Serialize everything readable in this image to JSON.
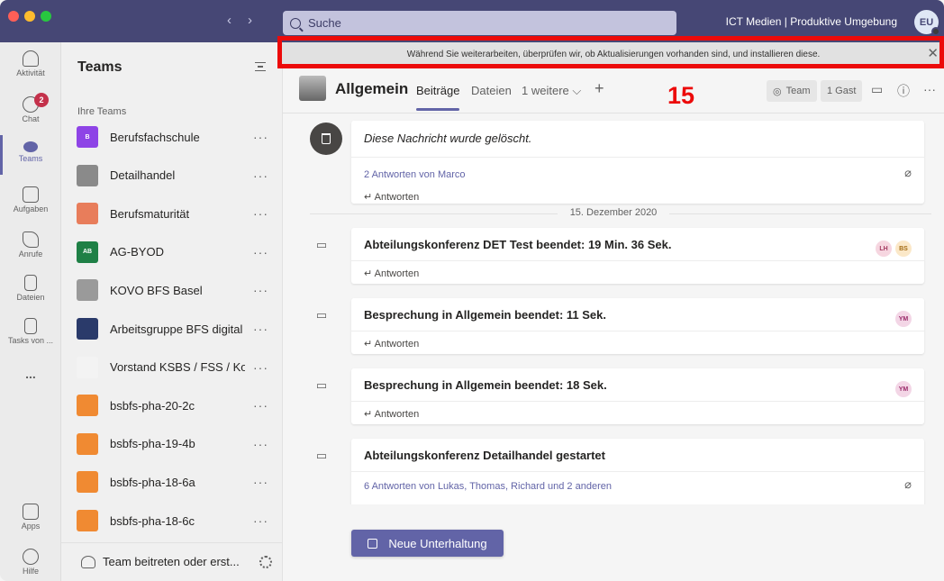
{
  "app": {
    "org_label": "ICT Medien | Produktive Umgebung",
    "avatar_initials": "EU",
    "search_placeholder": "Suche"
  },
  "rail": {
    "items": [
      {
        "label": "Aktivität"
      },
      {
        "label": "Chat",
        "badge": "2"
      },
      {
        "label": "Teams"
      },
      {
        "label": "Aufgaben"
      },
      {
        "label": "Anrufe"
      },
      {
        "label": "Dateien"
      },
      {
        "label": "Tasks von ..."
      },
      {
        "label": "..."
      },
      {
        "label": "Apps"
      },
      {
        "label": "Hilfe"
      }
    ]
  },
  "teams_panel": {
    "title": "Teams",
    "section": "Ihre Teams",
    "teams": [
      {
        "name": "Berufsfachschule",
        "tile": "B",
        "color": "#8e44e6"
      },
      {
        "name": "Detailhandel",
        "tile": "",
        "color": "#8a8a8a"
      },
      {
        "name": "Berufsmaturität",
        "tile": "",
        "color": "#e87d5b"
      },
      {
        "name": "AG-BYOD",
        "tile": "AB",
        "color": "#1f8046"
      },
      {
        "name": "KOVO BFS Basel",
        "tile": "",
        "color": "#9a9a9a"
      },
      {
        "name": "Arbeitsgruppe BFS digital",
        "tile": "",
        "color": "#2a3a6a"
      },
      {
        "name": "Vorstand KSBS / FSS / Ko...",
        "tile": "",
        "color": "#f3f3f3"
      },
      {
        "name": "bsbfs-pha-20-2c",
        "tile": "",
        "color": "#f08a32"
      },
      {
        "name": "bsbfs-pha-19-4b",
        "tile": "",
        "color": "#f08a32"
      },
      {
        "name": "bsbfs-pha-18-6a",
        "tile": "",
        "color": "#f08a32"
      },
      {
        "name": "bsbfs-pha-18-6c",
        "tile": "",
        "color": "#f08a32"
      }
    ],
    "more": "···",
    "join_label": "Team beitreten oder erst..."
  },
  "update_bar": {
    "text": "Während Sie weiterarbeiten, überprüfen wir, ob Aktualisierungen vorhanden sind, und installieren diese.",
    "close": "✕"
  },
  "annotation": {
    "number": "15"
  },
  "channel": {
    "name": "Allgemein",
    "tabs": [
      "Beiträge",
      "Dateien",
      "1 weitere ⌵"
    ],
    "add": "+",
    "team_pill": "Team",
    "guest_pill": "1 Gast"
  },
  "feed": {
    "deleted_message": "Diese Nachricht wurde gelöscht.",
    "deleted_replies": "2 Antworten von Marco",
    "reply_label": "Antworten",
    "date_separator": "15. Dezember 2020",
    "messages": [
      {
        "title": "Abteilungskonferenz DET Test beendet: 19 Min. 36 Sek.",
        "avatars": [
          {
            "initials": "LH",
            "bg": "#f6d6e0",
            "fg": "#a33a60"
          },
          {
            "initials": "BS",
            "bg": "#fbe8c8",
            "fg": "#a36a12"
          }
        ]
      },
      {
        "title": "Besprechung in Allgemein beendet: 11 Sek.",
        "avatars": [
          {
            "initials": "YM",
            "bg": "#f3d6e6",
            "fg": "#9a2a6a"
          }
        ]
      },
      {
        "title": "Besprechung in Allgemein beendet: 18 Sek.",
        "avatars": [
          {
            "initials": "YM",
            "bg": "#f3d6e6",
            "fg": "#9a2a6a"
          }
        ]
      },
      {
        "title": "Abteilungskonferenz Detailhandel gestartet",
        "replies": "6 Antworten von Lukas, Thomas, Richard und 2 anderen"
      }
    ]
  },
  "new_conversation": "Neue Unterhaltung"
}
